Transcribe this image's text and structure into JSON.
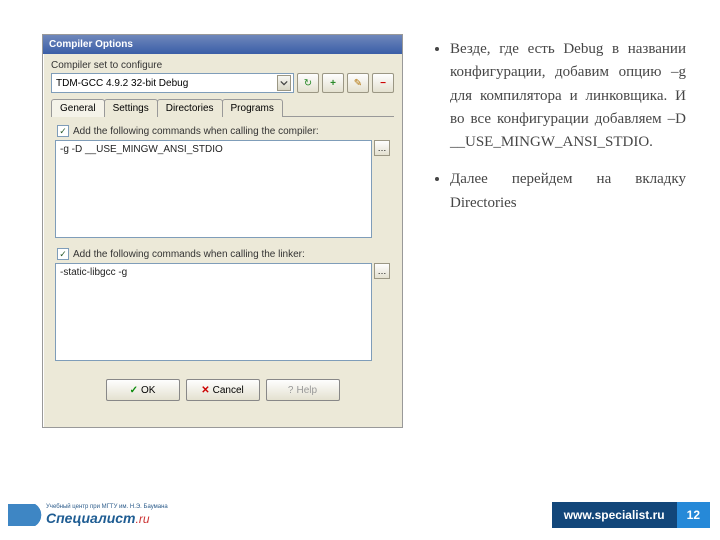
{
  "window": {
    "title": "Compiler Options",
    "compiler_set_label": "Compiler set to configure",
    "compiler_set_value": "TDM-GCC 4.9.2 32-bit Debug",
    "tabs": [
      "General",
      "Settings",
      "Directories",
      "Programs"
    ],
    "compiler_check_label": "Add the following commands when calling the compiler:",
    "compiler_commands": "-g -D __USE_MINGW_ANSI_STDIO",
    "linker_check_label": "Add the following commands when calling the linker:",
    "linker_commands": "-static-libgcc -g",
    "buttons": {
      "ok": "OK",
      "cancel": "Cancel",
      "help": "Help"
    }
  },
  "notes": {
    "item1": "Везде, где есть Debug в названии конфигурации, добавим опцию –g для компилятора и линковщика. И во все конфигурации добавляем –D __USE_MINGW_ANSI_STDIO.",
    "item2": "Далее перейдем на вкладку Directories"
  },
  "footer": {
    "logo_sub": "Учебный центр при МГТУ им. Н.Э. Баумана",
    "logo_main": "Специалист",
    "logo_suffix": ".ru",
    "site": "www.specialist.ru",
    "page": "12"
  },
  "icons": {
    "refresh": "↻",
    "add": "+",
    "remove": "−",
    "rename": "✎",
    "more": "…",
    "check": "✓",
    "help": "?"
  }
}
